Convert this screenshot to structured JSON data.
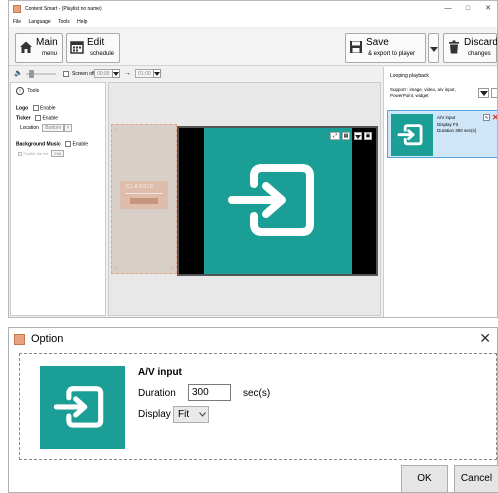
{
  "window": {
    "title": "Content Smart - (Playlist no name)",
    "menu": [
      "File",
      "Language",
      "Tools",
      "Help"
    ]
  },
  "toolbar": {
    "main_label": "Main",
    "main_sub": "menu",
    "edit_label": "Edit",
    "edit_sub": "schedule",
    "save_label": "Save",
    "save_sub": "& export to player",
    "discard_label": "Discard",
    "discard_sub": "changes"
  },
  "controls": {
    "screen_off_label": "Screen off",
    "time_from": "00:00",
    "time_to": "01:00"
  },
  "tools": {
    "title": "Tools",
    "logo_label": "Logo",
    "ticker_label": "Ticker",
    "enable_label": "Enable",
    "location_label": "Location",
    "location_value": "Bottom",
    "music_label": "Background Music",
    "music_hint": "Shuffle the list",
    "music_edit": "Edit",
    "classic_text": "CLASSIC"
  },
  "playback": {
    "title": "Looping playback",
    "support_text": "Support : image, video, a/v input, PowerPoint, widget",
    "item": {
      "name": "A/V input",
      "display": "Display Fit",
      "duration": "Duration  300  sec(s)"
    }
  },
  "dialog": {
    "title": "Option",
    "heading": "A/V input",
    "duration_label": "Duration",
    "duration_value": "300",
    "duration_unit": "sec(s)",
    "display_label": "Display",
    "display_value": "Fit",
    "ok_label": "OK",
    "cancel_label": "Cancel"
  },
  "colors": {
    "teal": "#1a9e96",
    "accent_blue": "#3b8ad8",
    "delete_red": "#d93025"
  }
}
